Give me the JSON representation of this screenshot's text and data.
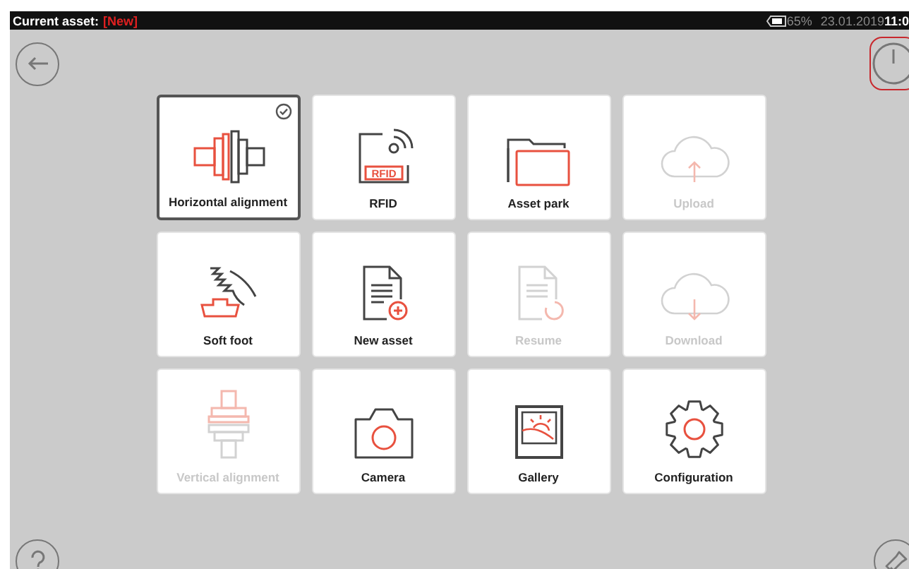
{
  "status_bar": {
    "asset_label": "Current asset:",
    "asset_value": "[New]",
    "battery": "65%",
    "date": "23.01.2019",
    "time": "11:0"
  },
  "power_button": {
    "highlighted": true
  },
  "tiles": [
    {
      "label": "Horizontal alignment",
      "selected": true,
      "disabled": false
    },
    {
      "label": "RFID",
      "selected": false,
      "disabled": false,
      "icon_text": "RFID"
    },
    {
      "label": "Asset park",
      "selected": false,
      "disabled": false
    },
    {
      "label": "Upload",
      "selected": false,
      "disabled": true
    },
    {
      "label": "Soft foot",
      "selected": false,
      "disabled": false
    },
    {
      "label": "New asset",
      "selected": false,
      "disabled": false
    },
    {
      "label": "Resume",
      "selected": false,
      "disabled": true
    },
    {
      "label": "Download",
      "selected": false,
      "disabled": true
    },
    {
      "label": "Vertical alignment",
      "selected": false,
      "disabled": true
    },
    {
      "label": "Camera",
      "selected": false,
      "disabled": false
    },
    {
      "label": "Gallery",
      "selected": false,
      "disabled": false
    },
    {
      "label": "Configuration",
      "selected": false,
      "disabled": false
    }
  ]
}
